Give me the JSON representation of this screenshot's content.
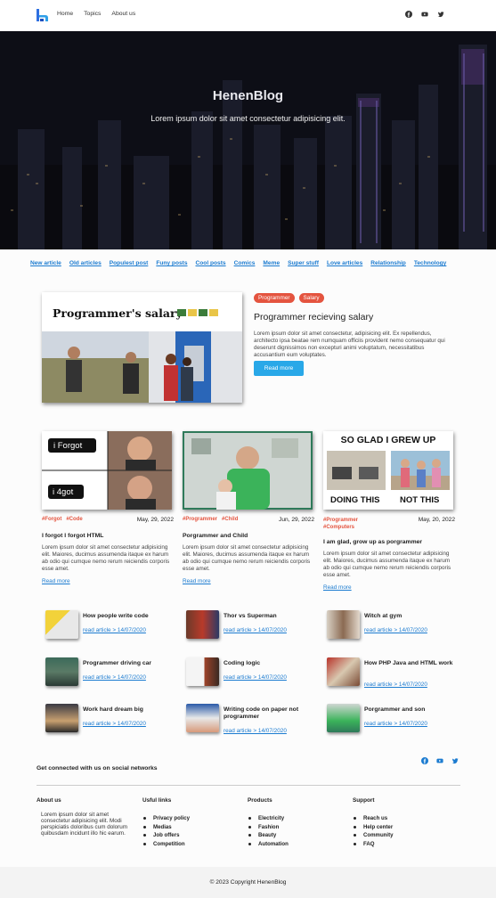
{
  "nav": {
    "links": [
      "Home",
      "Topics",
      "About us"
    ],
    "social_icons": [
      "facebook-icon",
      "youtube-icon",
      "twitter-icon"
    ]
  },
  "hero": {
    "title": "HenenBlog",
    "subtitle": "Lorem ipsum dolor sit amet consectetur adipisicing elit."
  },
  "categories": [
    "New article",
    "Old articles",
    "Populest post",
    "Funy posts",
    "Cool posts",
    "Comics",
    "Meme",
    "Super stuff",
    "Love articles",
    "Relationship",
    "Technology"
  ],
  "featured": {
    "image_caption": "Programmer's salary",
    "tags": [
      "Programmer",
      "Salary"
    ],
    "title": "Programmer recieving salary",
    "text": "Lorem ipsum dolor sit amet consectetur, adipisicing elit. Ex repellendus, architecto ipsa beatae rem numquam officiis provident nemo consequatur qui deserunt dignissimos non excepturi animi voluptatum, necessitatibus accusantium eum voluptates.",
    "button": "Read more"
  },
  "cards": [
    {
      "img_text": [
        "i Forgot",
        "i 4got"
      ],
      "tags": [
        "#Forgot",
        "#Code"
      ],
      "date": "May, 29, 2022",
      "title": "I forgot I forgot HTML",
      "text": "Lorem ipsum dolor sit amet consectetur adipisicing elit. Maiores, ducimus assumenda itaque ex harum ab odio qui cumque nemo rerum reiciendis corporis esse amet.",
      "more": "Read more"
    },
    {
      "img_text": [],
      "tags": [
        "#Programmer",
        "#Child"
      ],
      "date": "Jun, 29, 2022",
      "title": "Porgrammer and Child",
      "text": "Lorem ipsum dolor sit amet consectetur adipisicing elit. Maiores, ducimus assumenda itaque ex harum ab odio qui cumque nemo rerum reiciendis corporis esse amet.",
      "more": "Read more"
    },
    {
      "img_text": [
        "SO GLAD I GREW UP",
        "DOING THIS",
        "NOT THIS"
      ],
      "tags": [
        "#Programmer",
        "#Computers"
      ],
      "date": "May, 20, 2022",
      "title": "I am glad, grow up as porgrammer",
      "text": "Lorem ipsum dolor sit amet consectetur adipisicing elit. Maiores, ducimus assumenda itaque ex harum ab odio qui cumque nemo rerum reiciendis corporis esse amet.",
      "more": "Read more"
    }
  ],
  "mini_articles": [
    {
      "title": "How people write code",
      "link": "read article > 14/07/2020"
    },
    {
      "title": "Thor vs Superman",
      "link": "read article > 14/07/2020"
    },
    {
      "title": "Witch at gym",
      "link": "read article > 14/07/2020"
    },
    {
      "title": "Programmer driving car",
      "link": "read article > 14/07/2020"
    },
    {
      "title": "Coding logic",
      "link": "read article > 14/07/2020"
    },
    {
      "title": "How PHP Java and HTML work",
      "link": "read article > 14/07/2020"
    },
    {
      "title": "Work hard dream big",
      "link": "read article > 14/07/2020"
    },
    {
      "title": "Writing code on paper not programmer",
      "link": "read article > 14/07/2020"
    },
    {
      "title": "Porgrammer and son",
      "link": "read article > 14/07/2020"
    }
  ],
  "connect": {
    "text": "Get connected with us on social networks"
  },
  "footer": {
    "about_title": "About us",
    "about_text": "Lorem ipsum dolor sit amet consectetur adipisicing elit. Modi perspiciatis doloribus cum dolorum quibusdam incidunt illo hic earum.",
    "useful_title": "Usful links",
    "useful": [
      "Privacy policy",
      "Medias",
      "Job offers",
      "Competition"
    ],
    "products_title": "Products",
    "products": [
      "Electricity",
      "Fashion",
      "Beauty",
      "Automation"
    ],
    "support_title": "Support",
    "support": [
      "Reach us",
      "Help center",
      "Community",
      "FAQ"
    ],
    "copyright": "© 2023 Copyright HenenBlog"
  },
  "colors": {
    "accent": "#29a8e8",
    "tag": "#e4543f",
    "link": "#1b7bd0"
  }
}
